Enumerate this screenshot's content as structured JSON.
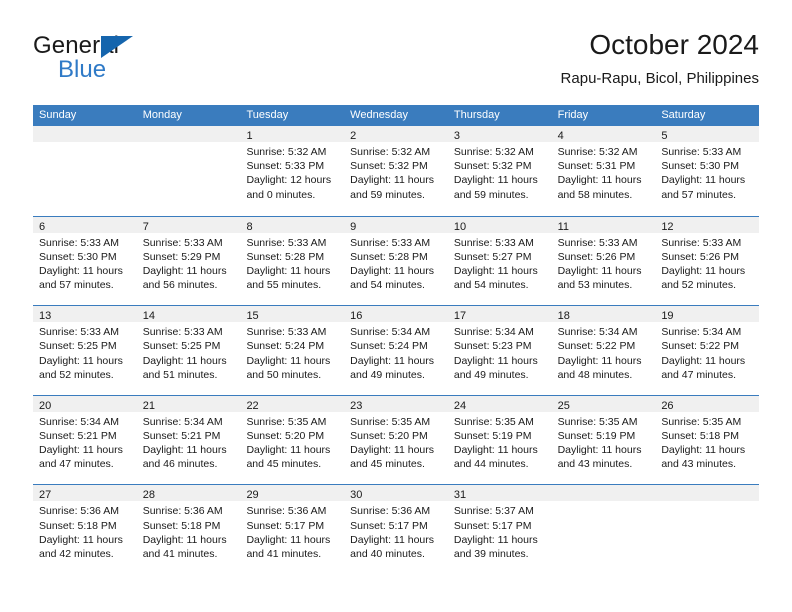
{
  "brand": {
    "word_general": "General",
    "word_blue": "Blue",
    "triangle_color": "#1565ad",
    "blue_text_color": "#2f7ac7"
  },
  "header": {
    "month_title": "October 2024",
    "location": "Rapu-Rapu, Bicol, Philippines"
  },
  "theme": {
    "header_blue": "#3a7cbe",
    "day_band_gray": "#f0f0f0",
    "text_color": "#1a1a1a"
  },
  "calendar": {
    "weekdays": [
      "Sunday",
      "Monday",
      "Tuesday",
      "Wednesday",
      "Thursday",
      "Friday",
      "Saturday"
    ],
    "weeks": [
      [
        {
          "day": "",
          "empty": true,
          "lines": []
        },
        {
          "day": "",
          "empty": true,
          "lines": []
        },
        {
          "day": "1",
          "lines": [
            "Sunrise: 5:32 AM",
            "Sunset: 5:33 PM",
            "Daylight: 12 hours",
            "and 0 minutes."
          ]
        },
        {
          "day": "2",
          "lines": [
            "Sunrise: 5:32 AM",
            "Sunset: 5:32 PM",
            "Daylight: 11 hours",
            "and 59 minutes."
          ]
        },
        {
          "day": "3",
          "lines": [
            "Sunrise: 5:32 AM",
            "Sunset: 5:32 PM",
            "Daylight: 11 hours",
            "and 59 minutes."
          ]
        },
        {
          "day": "4",
          "lines": [
            "Sunrise: 5:32 AM",
            "Sunset: 5:31 PM",
            "Daylight: 11 hours",
            "and 58 minutes."
          ]
        },
        {
          "day": "5",
          "lines": [
            "Sunrise: 5:33 AM",
            "Sunset: 5:30 PM",
            "Daylight: 11 hours",
            "and 57 minutes."
          ]
        }
      ],
      [
        {
          "day": "6",
          "lines": [
            "Sunrise: 5:33 AM",
            "Sunset: 5:30 PM",
            "Daylight: 11 hours",
            "and 57 minutes."
          ]
        },
        {
          "day": "7",
          "lines": [
            "Sunrise: 5:33 AM",
            "Sunset: 5:29 PM",
            "Daylight: 11 hours",
            "and 56 minutes."
          ]
        },
        {
          "day": "8",
          "lines": [
            "Sunrise: 5:33 AM",
            "Sunset: 5:28 PM",
            "Daylight: 11 hours",
            "and 55 minutes."
          ]
        },
        {
          "day": "9",
          "lines": [
            "Sunrise: 5:33 AM",
            "Sunset: 5:28 PM",
            "Daylight: 11 hours",
            "and 54 minutes."
          ]
        },
        {
          "day": "10",
          "lines": [
            "Sunrise: 5:33 AM",
            "Sunset: 5:27 PM",
            "Daylight: 11 hours",
            "and 54 minutes."
          ]
        },
        {
          "day": "11",
          "lines": [
            "Sunrise: 5:33 AM",
            "Sunset: 5:26 PM",
            "Daylight: 11 hours",
            "and 53 minutes."
          ]
        },
        {
          "day": "12",
          "lines": [
            "Sunrise: 5:33 AM",
            "Sunset: 5:26 PM",
            "Daylight: 11 hours",
            "and 52 minutes."
          ]
        }
      ],
      [
        {
          "day": "13",
          "lines": [
            "Sunrise: 5:33 AM",
            "Sunset: 5:25 PM",
            "Daylight: 11 hours",
            "and 52 minutes."
          ]
        },
        {
          "day": "14",
          "lines": [
            "Sunrise: 5:33 AM",
            "Sunset: 5:25 PM",
            "Daylight: 11 hours",
            "and 51 minutes."
          ]
        },
        {
          "day": "15",
          "lines": [
            "Sunrise: 5:33 AM",
            "Sunset: 5:24 PM",
            "Daylight: 11 hours",
            "and 50 minutes."
          ]
        },
        {
          "day": "16",
          "lines": [
            "Sunrise: 5:34 AM",
            "Sunset: 5:24 PM",
            "Daylight: 11 hours",
            "and 49 minutes."
          ]
        },
        {
          "day": "17",
          "lines": [
            "Sunrise: 5:34 AM",
            "Sunset: 5:23 PM",
            "Daylight: 11 hours",
            "and 49 minutes."
          ]
        },
        {
          "day": "18",
          "lines": [
            "Sunrise: 5:34 AM",
            "Sunset: 5:22 PM",
            "Daylight: 11 hours",
            "and 48 minutes."
          ]
        },
        {
          "day": "19",
          "lines": [
            "Sunrise: 5:34 AM",
            "Sunset: 5:22 PM",
            "Daylight: 11 hours",
            "and 47 minutes."
          ]
        }
      ],
      [
        {
          "day": "20",
          "lines": [
            "Sunrise: 5:34 AM",
            "Sunset: 5:21 PM",
            "Daylight: 11 hours",
            "and 47 minutes."
          ]
        },
        {
          "day": "21",
          "lines": [
            "Sunrise: 5:34 AM",
            "Sunset: 5:21 PM",
            "Daylight: 11 hours",
            "and 46 minutes."
          ]
        },
        {
          "day": "22",
          "lines": [
            "Sunrise: 5:35 AM",
            "Sunset: 5:20 PM",
            "Daylight: 11 hours",
            "and 45 minutes."
          ]
        },
        {
          "day": "23",
          "lines": [
            "Sunrise: 5:35 AM",
            "Sunset: 5:20 PM",
            "Daylight: 11 hours",
            "and 45 minutes."
          ]
        },
        {
          "day": "24",
          "lines": [
            "Sunrise: 5:35 AM",
            "Sunset: 5:19 PM",
            "Daylight: 11 hours",
            "and 44 minutes."
          ]
        },
        {
          "day": "25",
          "lines": [
            "Sunrise: 5:35 AM",
            "Sunset: 5:19 PM",
            "Daylight: 11 hours",
            "and 43 minutes."
          ]
        },
        {
          "day": "26",
          "lines": [
            "Sunrise: 5:35 AM",
            "Sunset: 5:18 PM",
            "Daylight: 11 hours",
            "and 43 minutes."
          ]
        }
      ],
      [
        {
          "day": "27",
          "lines": [
            "Sunrise: 5:36 AM",
            "Sunset: 5:18 PM",
            "Daylight: 11 hours",
            "and 42 minutes."
          ]
        },
        {
          "day": "28",
          "lines": [
            "Sunrise: 5:36 AM",
            "Sunset: 5:18 PM",
            "Daylight: 11 hours",
            "and 41 minutes."
          ]
        },
        {
          "day": "29",
          "lines": [
            "Sunrise: 5:36 AM",
            "Sunset: 5:17 PM",
            "Daylight: 11 hours",
            "and 41 minutes."
          ]
        },
        {
          "day": "30",
          "lines": [
            "Sunrise: 5:36 AM",
            "Sunset: 5:17 PM",
            "Daylight: 11 hours",
            "and 40 minutes."
          ]
        },
        {
          "day": "31",
          "lines": [
            "Sunrise: 5:37 AM",
            "Sunset: 5:17 PM",
            "Daylight: 11 hours",
            "and 39 minutes."
          ]
        },
        {
          "day": "",
          "empty": true,
          "lines": []
        },
        {
          "day": "",
          "empty": true,
          "lines": []
        }
      ]
    ]
  }
}
